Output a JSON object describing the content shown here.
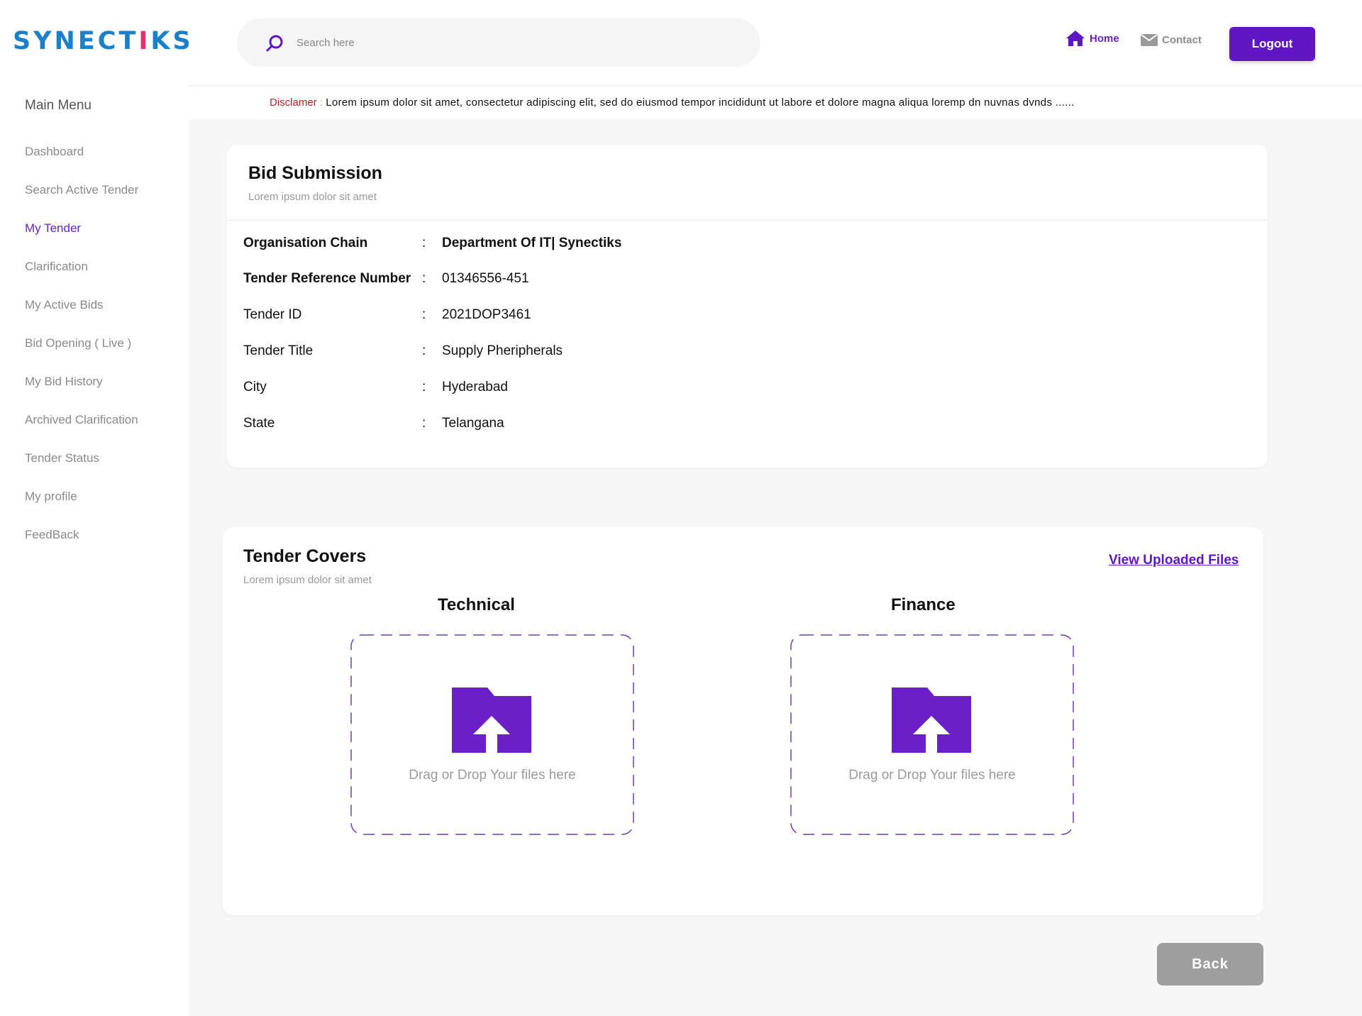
{
  "brand": {
    "logo_pre": "SYNECT",
    "logo_i": "I",
    "logo_post": "KS",
    "colors": {
      "primary": "#1b80c7",
      "accent": "#e0336b"
    }
  },
  "sidebar": {
    "title": "Main Menu",
    "items": [
      {
        "label": "Dashboard",
        "active": false
      },
      {
        "label": "Search Active Tender",
        "active": false
      },
      {
        "label": "My Tender",
        "active": true
      },
      {
        "label": "Clarification",
        "active": false
      },
      {
        "label": "My Active Bids",
        "active": false
      },
      {
        "label": "Bid Opening ( Live )",
        "active": false
      },
      {
        "label": "My Bid History",
        "active": false
      },
      {
        "label": "Archived Clarification",
        "active": false
      },
      {
        "label": "Tender Status",
        "active": false
      },
      {
        "label": "My profile",
        "active": false
      },
      {
        "label": "FeedBack",
        "active": false
      }
    ]
  },
  "header": {
    "search": {
      "placeholder": "Search here",
      "value": "",
      "icon": "search-icon"
    },
    "home_label": "Home",
    "contact_label": "Contact",
    "logout_label": "Logout",
    "accent_color": "#5f17c4"
  },
  "disclaimer": {
    "label": "Disclamer",
    "separator": ":",
    "text": "Lorem ipsum dolor sit amet, consectetur adipiscing elit, sed do eiusmod tempor incididunt ut labore et dolore magna aliqua loremp dn  nuvnas dvnds ......"
  },
  "bid_submission": {
    "title": "Bid Submission",
    "subtitle": "Lorem ipsum dolor sit amet",
    "rows": [
      {
        "label": "Organisation  Chain",
        "colon": ":",
        "value": "Department Of IT| Synectiks"
      },
      {
        "label": "Tender Reference Number",
        "colon": ":",
        "value": "01346556-451"
      },
      {
        "label": "Tender ID",
        "colon": ":",
        "value": "2021DOP3461"
      },
      {
        "label": "Tender Title",
        "colon": ":",
        "value": "Supply Pheripherals"
      },
      {
        "label": "City",
        "colon": ":",
        "value": "Hyderabad"
      },
      {
        "label": "State",
        "colon": ":",
        "value": "Telangana"
      }
    ]
  },
  "tender_covers": {
    "title": "Tender Covers",
    "subtitle": "Lorem ipsum dolor sit amet",
    "view_link": "View Uploaded Files",
    "technical": {
      "heading": "Technical",
      "drop_text": "Drag or Drop Your files here"
    },
    "finance": {
      "heading": "Finance",
      "drop_text": "Drag or Drop Your files here"
    }
  },
  "back_label": "Back"
}
